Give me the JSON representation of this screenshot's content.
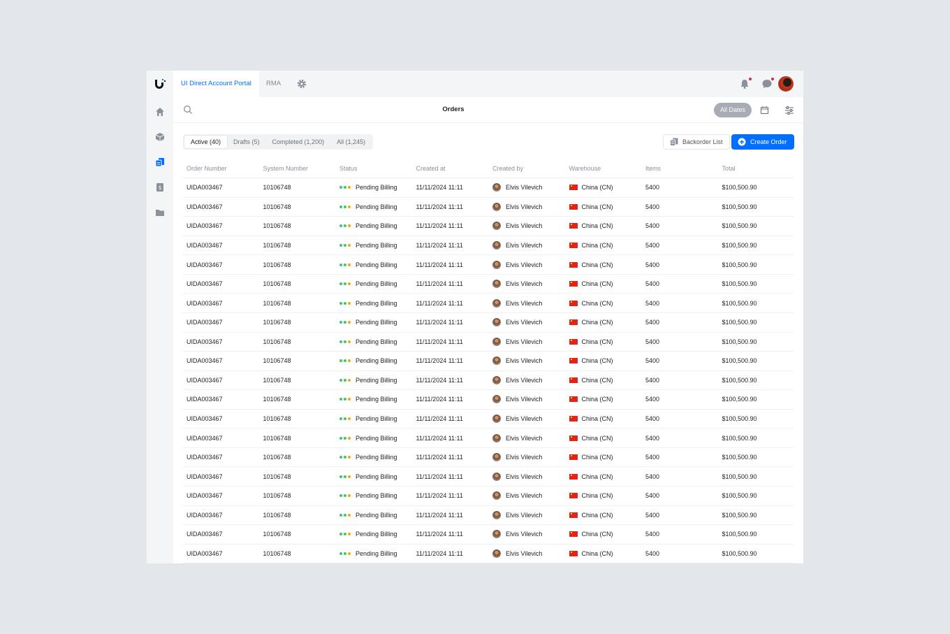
{
  "app": {
    "tabs": [
      {
        "label": "UI Direct Account Portal",
        "active": true
      },
      {
        "label": "RMA",
        "active": false
      }
    ],
    "page_title": "Orders",
    "date_filter": "All Dates"
  },
  "sidebar": {
    "items": [
      {
        "icon": "home-icon"
      },
      {
        "icon": "box-icon"
      },
      {
        "icon": "orders-icon",
        "active": true
      },
      {
        "icon": "invoice-icon"
      },
      {
        "icon": "folder-icon"
      }
    ]
  },
  "segments": [
    {
      "label": "Active (40)",
      "active": true
    },
    {
      "label": "Drafts (5)",
      "active": false
    },
    {
      "label": "Completed (1,200)",
      "active": false
    },
    {
      "label": "All (1,245)",
      "active": false
    }
  ],
  "actions": {
    "backorder_label": "Backorder List",
    "create_label": "Create Order"
  },
  "colors": {
    "accent": "#006fff",
    "status_dots": [
      "#3fc66a",
      "#3fc66a",
      "#f5a623"
    ],
    "badge": "#e0293c"
  },
  "table": {
    "columns": [
      "Order Number",
      "System Number",
      "Status",
      "Created at",
      "Created by",
      "Warehouse",
      "Items",
      "Total"
    ],
    "rows": [
      [
        "UIDA003467",
        "10106748",
        "Pending Billing",
        "11/11/2024 11:11",
        "Elvis Vilevich",
        "China (CN)",
        "5400",
        "$100,500.90"
      ],
      [
        "UIDA003467",
        "10106748",
        "Pending Billing",
        "11/11/2024 11:11",
        "Elvis Vilevich",
        "China (CN)",
        "5400",
        "$100,500.90"
      ],
      [
        "UIDA003467",
        "10106748",
        "Pending Billing",
        "11/11/2024 11:11",
        "Elvis Vilevich",
        "China (CN)",
        "5400",
        "$100,500.90"
      ],
      [
        "UIDA003467",
        "10106748",
        "Pending Billing",
        "11/11/2024 11:11",
        "Elvis Vilevich",
        "China (CN)",
        "5400",
        "$100,500.90"
      ],
      [
        "UIDA003467",
        "10106748",
        "Pending Billing",
        "11/11/2024 11:11",
        "Elvis Vilevich",
        "China (CN)",
        "5400",
        "$100,500.90"
      ],
      [
        "UIDA003467",
        "10106748",
        "Pending Billing",
        "11/11/2024 11:11",
        "Elvis Vilevich",
        "China (CN)",
        "5400",
        "$100,500.90"
      ],
      [
        "UIDA003467",
        "10106748",
        "Pending Billing",
        "11/11/2024 11:11",
        "Elvis Vilevich",
        "China (CN)",
        "5400",
        "$100,500.90"
      ],
      [
        "UIDA003467",
        "10106748",
        "Pending Billing",
        "11/11/2024 11:11",
        "Elvis Vilevich",
        "China (CN)",
        "5400",
        "$100,500.90"
      ],
      [
        "UIDA003467",
        "10106748",
        "Pending Billing",
        "11/11/2024 11:11",
        "Elvis Vilevich",
        "China (CN)",
        "5400",
        "$100,500.90"
      ],
      [
        "UIDA003467",
        "10106748",
        "Pending Billing",
        "11/11/2024 11:11",
        "Elvis Vilevich",
        "China (CN)",
        "5400",
        "$100,500.90"
      ],
      [
        "UIDA003467",
        "10106748",
        "Pending Billing",
        "11/11/2024 11:11",
        "Elvis Vilevich",
        "China (CN)",
        "5400",
        "$100,500.90"
      ],
      [
        "UIDA003467",
        "10106748",
        "Pending Billing",
        "11/11/2024 11:11",
        "Elvis Vilevich",
        "China (CN)",
        "5400",
        "$100,500.90"
      ],
      [
        "UIDA003467",
        "10106748",
        "Pending Billing",
        "11/11/2024 11:11",
        "Elvis Vilevich",
        "China (CN)",
        "5400",
        "$100,500.90"
      ],
      [
        "UIDA003467",
        "10106748",
        "Pending Billing",
        "11/11/2024 11:11",
        "Elvis Vilevich",
        "China (CN)",
        "5400",
        "$100,500.90"
      ],
      [
        "UIDA003467",
        "10106748",
        "Pending Billing",
        "11/11/2024 11:11",
        "Elvis Vilevich",
        "China (CN)",
        "5400",
        "$100,500.90"
      ],
      [
        "UIDA003467",
        "10106748",
        "Pending Billing",
        "11/11/2024 11:11",
        "Elvis Vilevich",
        "China (CN)",
        "5400",
        "$100,500.90"
      ],
      [
        "UIDA003467",
        "10106748",
        "Pending Billing",
        "11/11/2024 11:11",
        "Elvis Vilevich",
        "China (CN)",
        "5400",
        "$100,500.90"
      ],
      [
        "UIDA003467",
        "10106748",
        "Pending Billing",
        "11/11/2024 11:11",
        "Elvis Vilevich",
        "China (CN)",
        "5400",
        "$100,500.90"
      ],
      [
        "UIDA003467",
        "10106748",
        "Pending Billing",
        "11/11/2024 11:11",
        "Elvis Vilevich",
        "China (CN)",
        "5400",
        "$100,500.90"
      ],
      [
        "UIDA003467",
        "10106748",
        "Pending Billing",
        "11/11/2024 11:11",
        "Elvis Vilevich",
        "China (CN)",
        "5400",
        "$100,500.90"
      ]
    ]
  }
}
